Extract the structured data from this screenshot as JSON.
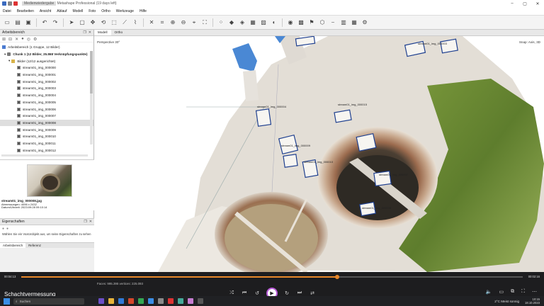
{
  "window": {
    "title_prefix": "",
    "doc_title": "Medienwiedergabe",
    "title_suffix": "Metashape Professional (19 days left)"
  },
  "menu": [
    "Datei",
    "Bearbeiten",
    "Ansicht",
    "Ablauf",
    "Modell",
    "Foto",
    "Ortho",
    "Werkzeuge",
    "Hilfe"
  ],
  "workspace": {
    "panel_title": "Arbeitsbereich",
    "root": "Arbeitsbereich (1 Gruppe, 12 Bilder)",
    "chunk": "Chunk 1 (12 Bilder, 25.868 Verknüpfungspunkte)",
    "folder": "Bilder (12/12 ausgerichtet)",
    "images": [
      "stream01_img_000000",
      "stream01_img_000001",
      "stream01_img_000002",
      "stream01_img_000003",
      "stream01_img_000004",
      "stream01_img_000005",
      "stream01_img_000006",
      "stream01_img_000007",
      "stream01_img_000008",
      "stream01_img_000009",
      "stream01_img_000010",
      "stream01_img_000011",
      "stream01_img_000012"
    ]
  },
  "preview": {
    "filename": "stream01_img_000008.jpg",
    "dimensions": "Abmessungen: 4096 x 2432",
    "date": "Datum/Uhrzeit: 2023:09:28 09:10:14"
  },
  "bottom_tabs": [
    "Arbeitsbereich",
    "Referenz"
  ],
  "properties": {
    "title": "Eigenschaften",
    "hint": "Wählen Sie ein Voxtorobjekt aus, um seine Eigenschaften zu sehen"
  },
  "viewport": {
    "tabs": [
      "Modell",
      "Ortho"
    ],
    "label_left": "Perspective 30°",
    "label_right": "Snap: Axis, 3D",
    "camera_labels": [
      "stream01_img_000004",
      "stream01_img_000015",
      "stream01_img_000009",
      "stream01_img_000010",
      "stream01_img_000007",
      "stream01_img_000008",
      "stream01_img_000003"
    ]
  },
  "player": {
    "time_current": "00:04:13",
    "time_total": "00:02:16",
    "progress": 0.63,
    "status": "Faces: 995.395 vertices: 225.093",
    "media_title": "Schachtvermessung"
  },
  "taskbar": {
    "search_placeholder": "Suchen",
    "weather": "2°C Meist sonnig",
    "time": "10:15",
    "date": "18.10.2023"
  },
  "colors": {
    "accent": "#e8882b",
    "play_ring": "#b85ad8",
    "camera": "#1e3f8f"
  }
}
